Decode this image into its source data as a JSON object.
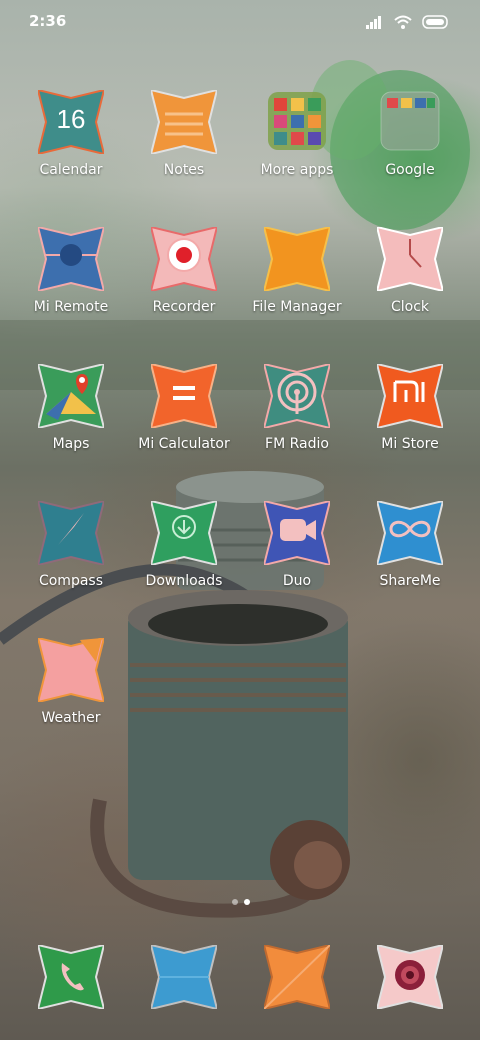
{
  "status_bar": {
    "time": "2:36",
    "icons": [
      "signal-icon",
      "wifi-icon",
      "battery-icon"
    ]
  },
  "apps": [
    {
      "label": "Calendar",
      "icon": "calendar-icon",
      "date": "16",
      "color": "#3f8d8a"
    },
    {
      "label": "Notes",
      "icon": "notes-icon",
      "color": "#f0953a"
    },
    {
      "label": "More apps",
      "icon": "folder-icon",
      "color": "#7fa14a"
    },
    {
      "label": "Google",
      "icon": "folder-icon",
      "color": "#9aa59a"
    },
    {
      "label": "Mi Remote",
      "icon": "remote-icon",
      "color": "#3d6fae"
    },
    {
      "label": "Recorder",
      "icon": "recorder-icon",
      "color": "#f3b9b9"
    },
    {
      "label": "File Manager",
      "icon": "folder-icon",
      "color": "#f2941f"
    },
    {
      "label": "Clock",
      "icon": "clock-icon",
      "color": "#f4bcbc"
    },
    {
      "label": "Maps",
      "icon": "maps-icon",
      "color": "#3a9c5a"
    },
    {
      "label": "Mi Calculator",
      "icon": "calculator-icon",
      "color": "#f2642b"
    },
    {
      "label": "FM Radio",
      "icon": "radio-icon",
      "color": "#3f8d80"
    },
    {
      "label": "Mi Store",
      "icon": "mi-store-icon",
      "color": "#f05a1f"
    },
    {
      "label": "Compass",
      "icon": "compass-icon",
      "color": "#2f7f8f"
    },
    {
      "label": "Downloads",
      "icon": "download-icon",
      "color": "#2f9f5f"
    },
    {
      "label": "Duo",
      "icon": "video-camera-icon",
      "color": "#3f55b5"
    },
    {
      "label": "ShareMe",
      "icon": "share-icon",
      "color": "#2f8fd0"
    },
    {
      "label": "Weather",
      "icon": "weather-icon",
      "color": "#f4a0a0"
    }
  ],
  "dock": [
    {
      "icon": "phone-icon",
      "color": "#2f9a4a"
    },
    {
      "icon": "messages-icon",
      "color": "#3d9bd0"
    },
    {
      "icon": "browser-icon",
      "color": "#f28c3c"
    },
    {
      "icon": "camera-icon",
      "color": "#f5c9c9"
    }
  ],
  "page_indicator": {
    "pages": 2,
    "current": 2
  }
}
